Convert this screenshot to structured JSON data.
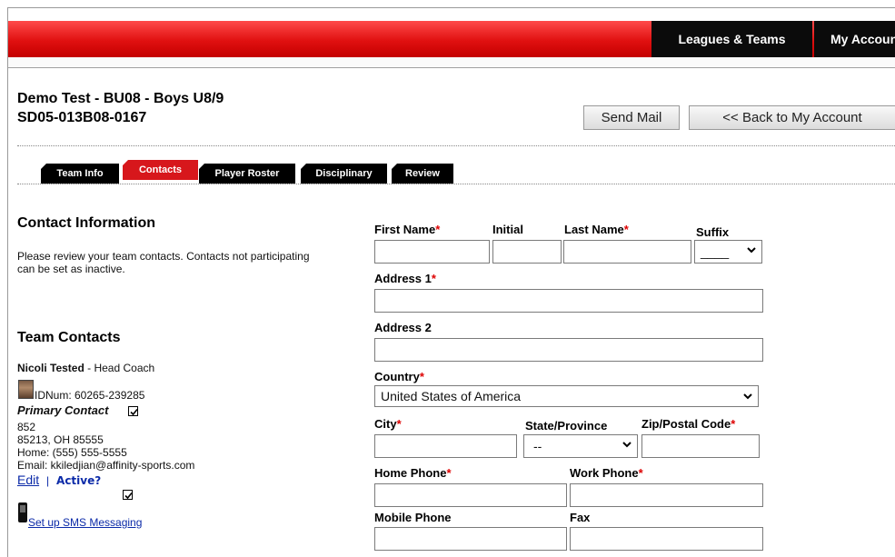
{
  "topnav": {
    "leagues_teams": "Leagues & Teams",
    "my_account": "My Account"
  },
  "header": {
    "team_title": "Demo Test - BU08 - Boys U8/9",
    "team_code": "SD05-013B08-0167",
    "send_mail_label": "Send Mail",
    "back_label": "<< Back to My Account"
  },
  "tabs": [
    {
      "label": "Team Info"
    },
    {
      "label": "Contacts"
    },
    {
      "label": "Player Roster"
    },
    {
      "label": "Disciplinary"
    },
    {
      "label": "Review"
    }
  ],
  "contact_info": {
    "heading": "Contact Information",
    "description": "Please review your team contacts.  Contacts not participating can be set as inactive."
  },
  "team_contacts": {
    "heading": "Team Contacts",
    "name": "Nicoli Tested",
    "role": " - Head Coach",
    "idnum": "IDNum: 60265-239285",
    "primary_contact_label": "Primary Contact",
    "address_line1": "852",
    "address_line2": "85213, OH 85555",
    "home_phone": "Home: (555) 555-5555",
    "email": "Email: kkiledjian@affinity-sports.com",
    "edit_label": "Edit",
    "separator": "|",
    "active_label": "Active?",
    "sms_label": "Set up SMS Messaging"
  },
  "form": {
    "first_name_label": "First Name",
    "initial_label": "Initial",
    "last_name_label": "Last Name",
    "suffix_label": "Suffix",
    "suffix_value": "____",
    "address1_label": "Address 1",
    "address2_label": "Address 2",
    "country_label": "Country",
    "country_value": "United States of America",
    "city_label": "City",
    "state_label": "State/Province",
    "state_value": "--",
    "zip_label": "Zip/Postal Code",
    "home_phone_label": "Home Phone",
    "work_phone_label": "Work Phone",
    "mobile_phone_label": "Mobile Phone",
    "fax_label": "Fax",
    "required_marker": "*"
  }
}
